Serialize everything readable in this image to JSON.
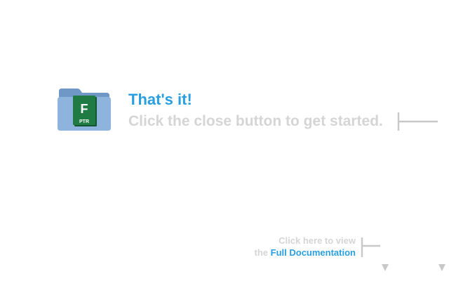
{
  "colors": {
    "accent": "#2a9fe0",
    "muted_text": "#d5d5d5",
    "guide_line": "#c8c8c8",
    "folder_blue": "#8eb3dc",
    "folder_blue_dark": "#6f98c7",
    "app_green": "#1f7a43",
    "app_green_dark": "#12572f"
  },
  "installer": {
    "icon": {
      "name": "folder-icon",
      "app_letter": "F",
      "app_tag": "PTR"
    },
    "title": "That's it!",
    "subtitle": "Click the close button to get started.",
    "docs": {
      "line1": "Click here to view",
      "prefix": "the",
      "link_label": "Full Documentation"
    }
  }
}
